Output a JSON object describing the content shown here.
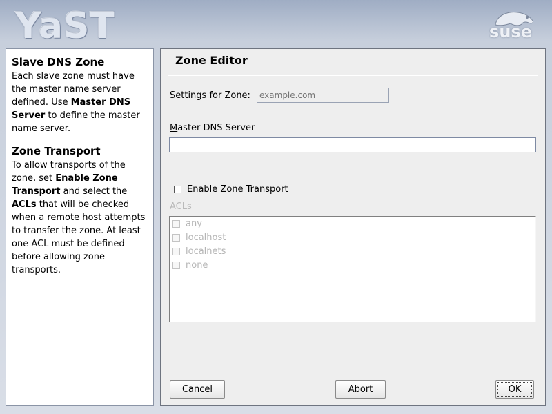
{
  "header": {
    "app_logo_text": "YaST",
    "vendor_logo_text": "suse"
  },
  "help": {
    "sections": [
      {
        "title": "Slave DNS Zone",
        "text_1": "Each slave zone must have the master name server defined. Use ",
        "bold_1": "Master DNS Server",
        "text_2": " to define the master name server."
      },
      {
        "title": "Zone Transport",
        "text_1": "To allow transports of the zone, set ",
        "bold_1": "Enable Zone Transport",
        "text_2": " and select the ",
        "bold_2": "ACLs",
        "text_3": " that will be checked when a remote host attempts to transfer the zone. At least one ACL must be defined before allowing zone transports."
      }
    ]
  },
  "editor": {
    "title": "Zone Editor",
    "settings_label": "Settings for Zone:",
    "zone_placeholder": "example.com",
    "master_label_first": "M",
    "master_label_rest": "aster DNS Server",
    "master_value": "",
    "enable_transport": {
      "label_pre": "Enable ",
      "label_u": "Z",
      "label_post": "one Transport",
      "checked": false
    },
    "acls_label_first": "A",
    "acls_label_rest": "CLs",
    "acls": [
      {
        "label": "any",
        "checked": false
      },
      {
        "label": "localhost",
        "checked": false
      },
      {
        "label": "localnets",
        "checked": false
      },
      {
        "label": "none",
        "checked": false
      }
    ]
  },
  "buttons": {
    "cancel_u": "C",
    "cancel_rest": "ancel",
    "abort_pre": "Abo",
    "abort_u": "r",
    "abort_post": "t",
    "ok_u": "O",
    "ok_rest": "K"
  }
}
